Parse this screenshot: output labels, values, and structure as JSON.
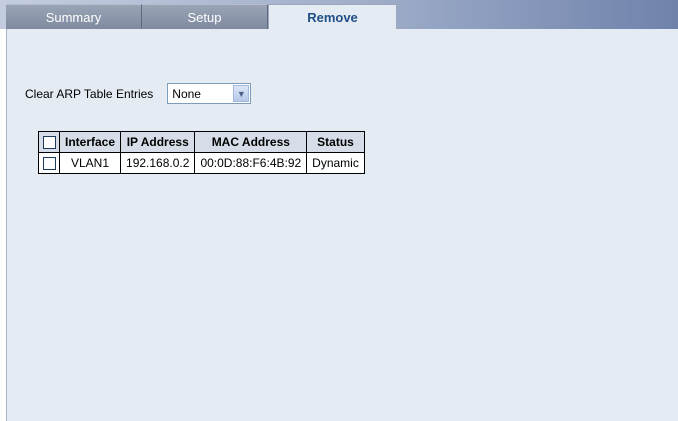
{
  "tabs": [
    {
      "label": "Summary",
      "active": false
    },
    {
      "label": "Setup",
      "active": false
    },
    {
      "label": "Remove",
      "active": true
    }
  ],
  "clear_arp": {
    "label": "Clear ARP Table Entries",
    "selected": "None"
  },
  "table": {
    "headers": [
      "Interface",
      "IP Address",
      "MAC Address",
      "Status"
    ],
    "rows": [
      {
        "interface": "VLAN1",
        "ip": "192.168.0.2",
        "mac": "00:0D:88:F6:4B:92",
        "status": "Dynamic"
      }
    ]
  },
  "colors": {
    "panel_bg": "#e5ebf3",
    "active_tab_text": "#1f4f84",
    "header_bg": "#d7dde8"
  },
  "icons": {
    "select_arrow": "chevron-down-icon",
    "checkbox": "checkbox"
  }
}
